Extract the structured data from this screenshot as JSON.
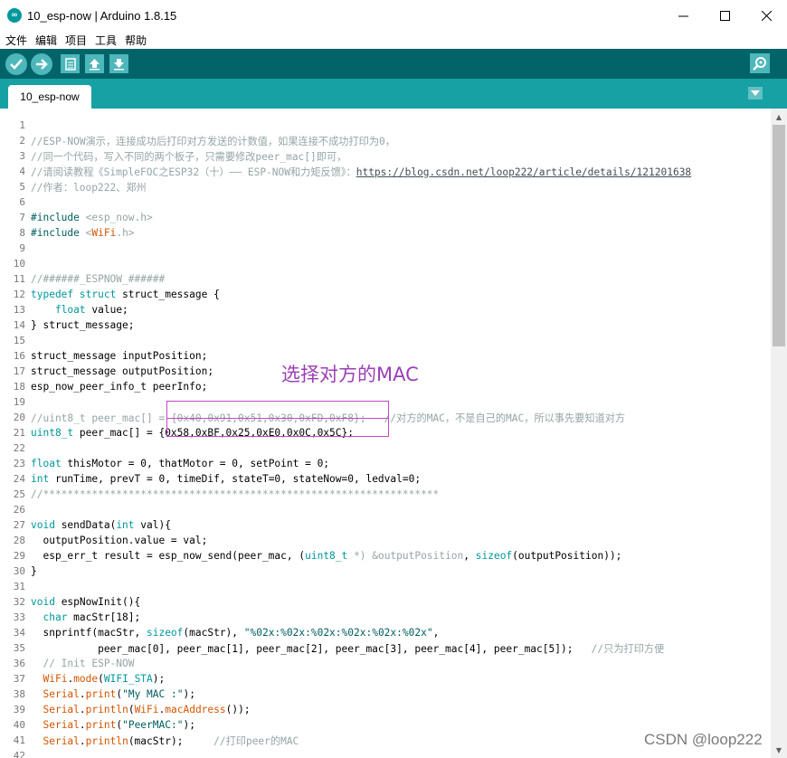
{
  "window": {
    "title": "10_esp-now | Arduino 1.8.15",
    "icon": "arduino-icon"
  },
  "menu": [
    "文件",
    "编辑",
    "项目",
    "工具",
    "帮助"
  ],
  "toolbar": {
    "buttons": [
      "verify-icon",
      "upload-icon",
      "new-icon",
      "open-icon",
      "save-icon"
    ],
    "right_button": "serial-monitor-icon",
    "accent": "#006468",
    "button_color": "#4db7bb"
  },
  "tabs": [
    {
      "label": "10_esp-now"
    }
  ],
  "annotation": "选择对方的MAC",
  "watermark": "CSDN @loop222",
  "colors": {
    "keyword": "#00979c",
    "function": "#d35400",
    "comment": "#95a5a6",
    "string": "#005c5f",
    "tabbar": "#17a1a5"
  },
  "code": [
    {
      "n": "1",
      "t": []
    },
    {
      "n": "2",
      "t": [
        [
          "c",
          "//ESP-NOW演示，连接成功后打印对方发送的计数值，如果连接不成功打印为0，"
        ]
      ]
    },
    {
      "n": "3",
      "t": [
        [
          "c",
          "//同一个代码，写入不同的两个板子，只需要修改peer_mac[]即可，"
        ]
      ]
    },
    {
      "n": "4",
      "t": [
        [
          "c",
          "//请阅读教程《SimpleFOC之ESP32（十）—— ESP-NOW和力矩反馈》："
        ],
        [
          "u",
          "https://blog.csdn.net/loop222/article/details/121201638"
        ]
      ]
    },
    {
      "n": "5",
      "t": [
        [
          "c",
          "//作者：loop222、郑州"
        ]
      ]
    },
    {
      "n": "6",
      "t": []
    },
    {
      "n": "7",
      "t": [
        [
          "s",
          "#include "
        ],
        [
          "c",
          "<esp_now.h>"
        ]
      ]
    },
    {
      "n": "8",
      "t": [
        [
          "s",
          "#include "
        ],
        [
          "c",
          "<"
        ],
        [
          "f",
          "WiFi"
        ],
        [
          "c",
          ".h>"
        ]
      ]
    },
    {
      "n": "9",
      "t": []
    },
    {
      "n": "10",
      "t": []
    },
    {
      "n": "11",
      "t": [
        [
          "c",
          "//######_ESPNOW_######"
        ]
      ]
    },
    {
      "n": "12",
      "t": [
        [
          "k",
          "typedef"
        ],
        [
          "p",
          " "
        ],
        [
          "k",
          "struct"
        ],
        [
          "p",
          " struct_message {"
        ]
      ]
    },
    {
      "n": "13",
      "t": [
        [
          "p",
          "    "
        ],
        [
          "k",
          "float"
        ],
        [
          "p",
          " value;"
        ]
      ]
    },
    {
      "n": "14",
      "t": [
        [
          "p",
          "} struct_message;"
        ]
      ]
    },
    {
      "n": "15",
      "t": []
    },
    {
      "n": "16",
      "t": [
        [
          "p",
          "struct_message inputPosition;"
        ]
      ]
    },
    {
      "n": "17",
      "t": [
        [
          "p",
          "struct_message outputPosition;"
        ]
      ]
    },
    {
      "n": "18",
      "t": [
        [
          "p",
          "esp_now_peer_info_t peerInfo;"
        ]
      ]
    },
    {
      "n": "19",
      "t": []
    },
    {
      "n": "20",
      "t": [
        [
          "c",
          "//uint8_t peer_mac[] = {0x40,0x91,0x51,0x30,0xFD,0xF8};   //对方的MAC，不是自己的MAC，所以事先要知道对方"
        ]
      ]
    },
    {
      "n": "21",
      "t": [
        [
          "k",
          "uint8_t"
        ],
        [
          "p",
          " peer_mac[] = {0x58,0xBF,0x25,0xE0,0x0C,0x5C};"
        ]
      ]
    },
    {
      "n": "22",
      "t": []
    },
    {
      "n": "23",
      "t": [
        [
          "k",
          "float"
        ],
        [
          "p",
          " thisMotor = 0, thatMotor = 0, setPoint = 0;"
        ]
      ]
    },
    {
      "n": "24",
      "t": [
        [
          "k",
          "int"
        ],
        [
          "p",
          " runTime, prevT = 0, timeDif, stateT=0, stateNow=0, ledval=0;"
        ]
      ]
    },
    {
      "n": "25",
      "t": [
        [
          "c",
          "//*****************************************************************"
        ]
      ]
    },
    {
      "n": "26",
      "t": []
    },
    {
      "n": "27",
      "t": [
        [
          "k",
          "void"
        ],
        [
          "p",
          " sendData("
        ],
        [
          "k",
          "int"
        ],
        [
          "p",
          " val){"
        ]
      ]
    },
    {
      "n": "28",
      "t": [
        [
          "p",
          "  outputPosition.value = val;"
        ]
      ]
    },
    {
      "n": "29",
      "t": [
        [
          "p",
          "  esp_err_t result = esp_now_send(peer_mac, ("
        ],
        [
          "k",
          "uint8_t"
        ],
        [
          "p",
          " "
        ],
        [
          "c",
          "*) &outputPosition"
        ],
        [
          "p",
          ", "
        ],
        [
          "k",
          "sizeof"
        ],
        [
          "p",
          "(outputPosition));"
        ]
      ]
    },
    {
      "n": "30",
      "t": [
        [
          "p",
          "}"
        ]
      ]
    },
    {
      "n": "31",
      "t": []
    },
    {
      "n": "32",
      "t": [
        [
          "k",
          "void"
        ],
        [
          "p",
          " espNowInit(){"
        ]
      ]
    },
    {
      "n": "33",
      "t": [
        [
          "p",
          "  "
        ],
        [
          "k",
          "char"
        ],
        [
          "p",
          " macStr[18];"
        ]
      ]
    },
    {
      "n": "34",
      "t": [
        [
          "p",
          "  snprintf(macStr, "
        ],
        [
          "k",
          "sizeof"
        ],
        [
          "p",
          "(macStr), "
        ],
        [
          "s",
          "\"%02x:%02x:%02x:%02x:%02x:%02x\""
        ],
        [
          "p",
          ","
        ]
      ]
    },
    {
      "n": "35",
      "t": [
        [
          "p",
          "           peer_mac[0], peer_mac[1], peer_mac[2], peer_mac[3], peer_mac[4], peer_mac[5]);   "
        ],
        [
          "c",
          "//只为打印方便"
        ]
      ]
    },
    {
      "n": "36",
      "t": [
        [
          "c",
          "  // Init ESP-NOW"
        ]
      ]
    },
    {
      "n": "37",
      "t": [
        [
          "p",
          "  "
        ],
        [
          "f",
          "WiFi"
        ],
        [
          "p",
          "."
        ],
        [
          "f",
          "mode"
        ],
        [
          "p",
          "("
        ],
        [
          "k",
          "WIFI_STA"
        ],
        [
          "p",
          ");"
        ]
      ]
    },
    {
      "n": "38",
      "t": [
        [
          "p",
          "  "
        ],
        [
          "f",
          "Serial"
        ],
        [
          "p",
          "."
        ],
        [
          "f",
          "print"
        ],
        [
          "p",
          "("
        ],
        [
          "s",
          "\"My MAC :\""
        ],
        [
          "p",
          ");"
        ]
      ]
    },
    {
      "n": "39",
      "t": [
        [
          "p",
          "  "
        ],
        [
          "f",
          "Serial"
        ],
        [
          "p",
          "."
        ],
        [
          "f",
          "println"
        ],
        [
          "p",
          "("
        ],
        [
          "f",
          "WiFi"
        ],
        [
          "p",
          "."
        ],
        [
          "f",
          "macAddress"
        ],
        [
          "p",
          "());"
        ]
      ]
    },
    {
      "n": "40",
      "t": [
        [
          "p",
          "  "
        ],
        [
          "f",
          "Serial"
        ],
        [
          "p",
          "."
        ],
        [
          "f",
          "print"
        ],
        [
          "p",
          "("
        ],
        [
          "s",
          "\"PeerMAC:\""
        ],
        [
          "p",
          ");"
        ]
      ]
    },
    {
      "n": "41",
      "t": [
        [
          "p",
          "  "
        ],
        [
          "f",
          "Serial"
        ],
        [
          "p",
          "."
        ],
        [
          "f",
          "println"
        ],
        [
          "p",
          "(macStr);     "
        ],
        [
          "c",
          "//打印peer的MAC"
        ]
      ]
    },
    {
      "n": "42",
      "t": []
    }
  ]
}
